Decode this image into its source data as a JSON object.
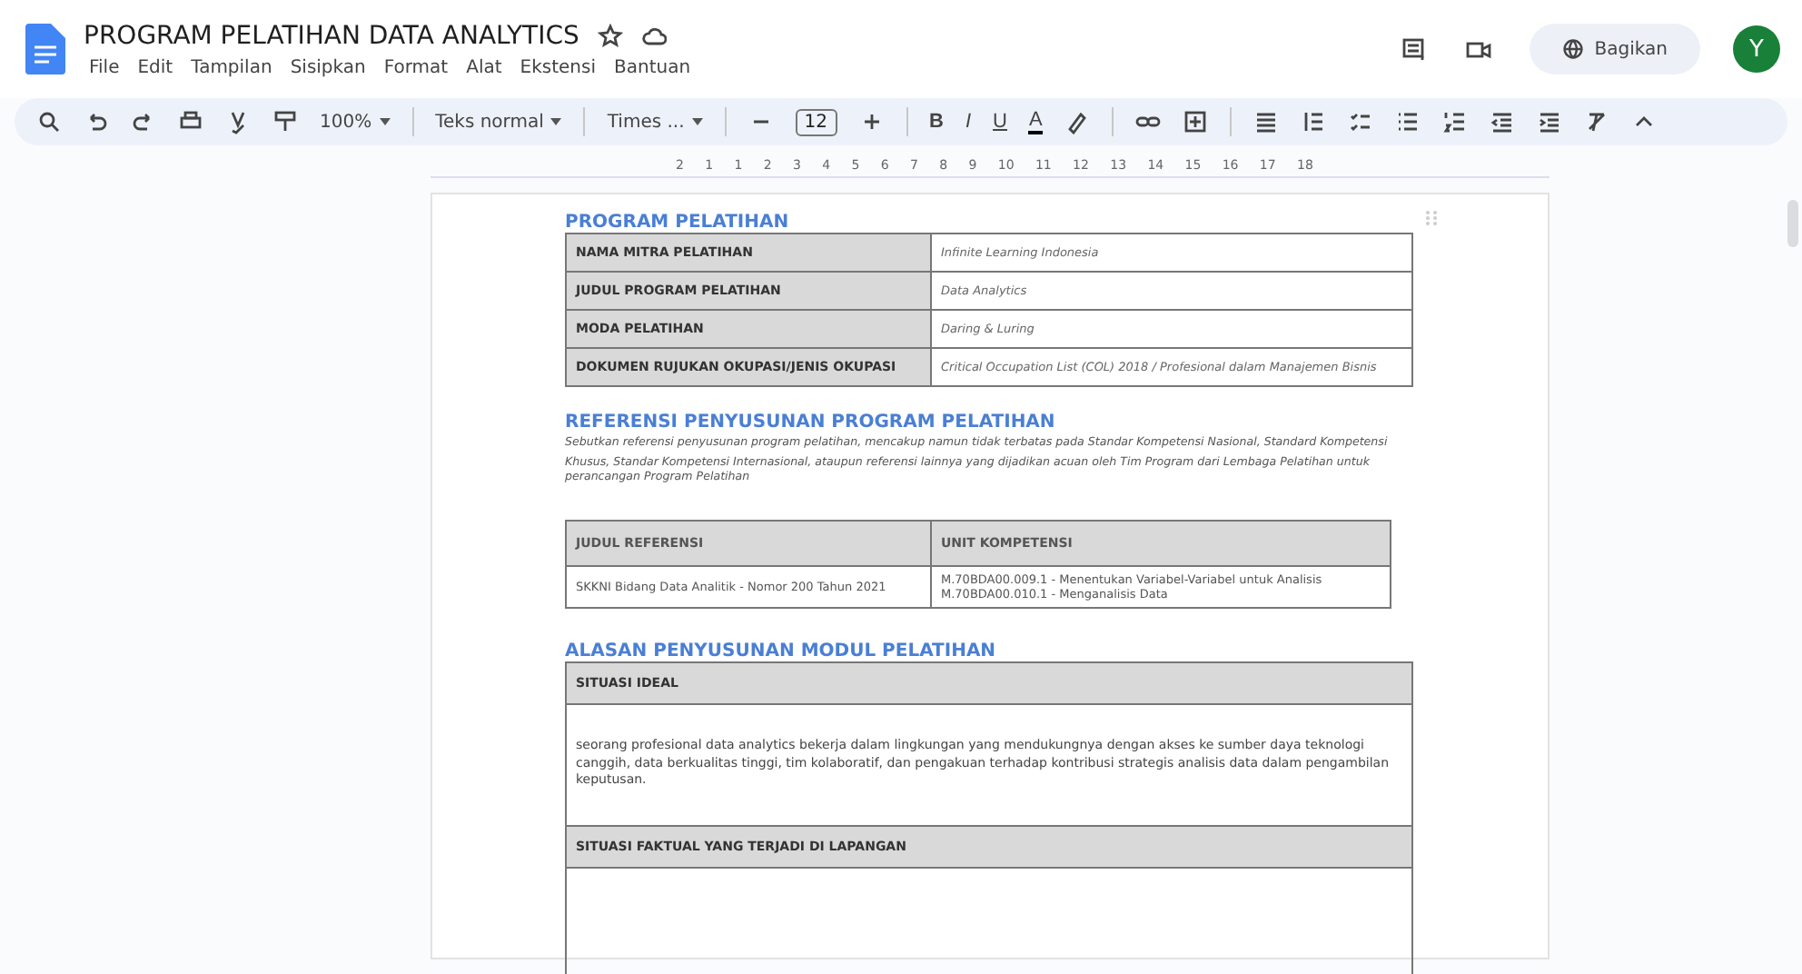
{
  "window": {
    "title": "PROGRAM PELATIHAN DATA ANALYTICS",
    "share_button": "Bagikan",
    "avatar": "Y"
  },
  "menu": [
    "File",
    "Edit",
    "Tampilan",
    "Sisipkan",
    "Format",
    "Alat",
    "Ekstensi",
    "Bantuan"
  ],
  "toolbar": {
    "zoom": "100%",
    "style": "Teks normal",
    "font": "Times ...",
    "font_size": "12",
    "bold": "B",
    "italic": "I",
    "underline": "U",
    "text_color": "A"
  },
  "ruler": {
    "labels": [
      "2",
      "1",
      "1",
      "2",
      "3",
      "4",
      "5",
      "6",
      "7",
      "8",
      "9",
      "10",
      "11",
      "12",
      "13",
      "14",
      "15",
      "16",
      "17",
      "18"
    ]
  },
  "document": {
    "section_1": {
      "heading": "PROGRAM PELATIHAN",
      "rows": [
        {
          "label": "NAMA MITRA PELATIHAN",
          "value": "Infinite Learning Indonesia"
        },
        {
          "label": "JUDUL PROGRAM PELATIHAN",
          "value": "Data Analytics"
        },
        {
          "label": "MODA PELATIHAN",
          "value": "Daring & Luring"
        },
        {
          "label": "DOKUMEN RUJUKAN OKUPASI/JENIS OKUPASI",
          "value": "Critical Occupation List (COL) 2018 / Profesional dalam Manajemen Bisnis"
        }
      ]
    },
    "section_2": {
      "heading": "REFERENSI PENYUSUNAN PROGRAM PELATIHAN",
      "description": [
        "Sebutkan referensi penyusunan program pelatihan, mencakup namun tidak terbatas pada Standar Kompetensi Nasional, Standard Kompetensi",
        "Khusus, Standar Kompetensi Internasional, ataupun referensi lainnya yang dijadikan acuan oleh Tim Program dari Lembaga Pelatihan untuk perancangan Program Pelatihan"
      ],
      "columns": [
        "JUDUL REFERENSI",
        "UNIT KOMPETENSI"
      ],
      "rows": [
        {
          "judul": "SKKNI Bidang Data Analitik - Nomor 200 Tahun 2021",
          "units": [
            "M.70BDA00.009.1 - Menentukan Variabel-Variabel untuk Analisis",
            "M.70BDA00.010.1 - Menganalisis Data"
          ]
        }
      ]
    },
    "section_3": {
      "heading": "ALASAN PENYUSUNAN MODUL PELATIHAN",
      "blocks": [
        {
          "title": "SITUASI IDEAL",
          "body": "seorang profesional data analytics bekerja dalam lingkungan yang mendukungnya dengan akses ke sumber daya teknologi canggih, data berkualitas tinggi, tim kolaboratif, dan pengakuan terhadap kontribusi strategis analisis data dalam pengambilan keputusan."
        },
        {
          "title": "SITUASI FAKTUAL YANG TERJADI DI LAPANGAN"
        }
      ]
    }
  }
}
